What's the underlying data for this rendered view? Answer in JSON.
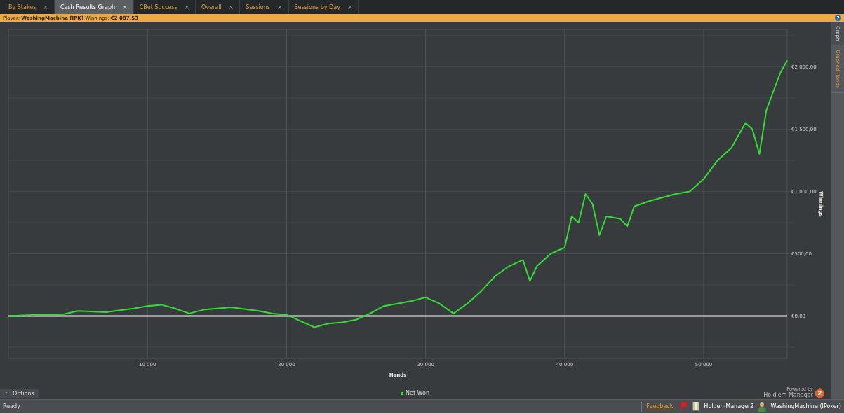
{
  "tabs": [
    {
      "label": "By Stakes",
      "selected": false,
      "close": "×"
    },
    {
      "label": "Cash Results Graph",
      "selected": true,
      "close": "×"
    },
    {
      "label": "CBet Success",
      "selected": false,
      "close": "×"
    },
    {
      "label": "Overall",
      "selected": false,
      "close": "×"
    },
    {
      "label": "Sessions",
      "selected": false,
      "close": "×"
    },
    {
      "label": "Sessions by Day",
      "selected": false,
      "close": "×"
    }
  ],
  "info_bar": {
    "player_label": "Player:",
    "player": "WashingMachine [IPK]",
    "winnings_label": "Winnings:",
    "winnings": "€2 087,53",
    "help": "?"
  },
  "side_tabs": [
    {
      "label": "Graph",
      "selected": true
    },
    {
      "label": "Graphed Hands",
      "selected": false
    }
  ],
  "graph": {
    "chart_data": {
      "type": "line",
      "grid": true,
      "xlabel": "Hands",
      "ylabel": "Winnings",
      "xlim": [
        0,
        56000
      ],
      "ylim": [
        -340,
        2300
      ],
      "xticks": [
        {
          "value": 10000,
          "label": "10 000"
        },
        {
          "value": 20000,
          "label": "20 000"
        },
        {
          "value": 30000,
          "label": "30 000"
        },
        {
          "value": 40000,
          "label": "40 000"
        },
        {
          "value": 50000,
          "label": "50 000"
        }
      ],
      "yticks": [
        {
          "value": 0,
          "label": "€0,00"
        },
        {
          "value": 500,
          "label": "€500,00"
        },
        {
          "value": 1000,
          "label": "€1 000,00"
        },
        {
          "value": 1500,
          "label": "€1 500,00"
        },
        {
          "value": 2000,
          "label": "€2 000,00"
        }
      ],
      "x": [
        0,
        2000,
        4000,
        5000,
        7000,
        9000,
        10000,
        11000,
        12000,
        13000,
        14000,
        16000,
        18000,
        19000,
        20000,
        21000,
        22000,
        23000,
        24000,
        25000,
        26000,
        27000,
        28000,
        29000,
        30000,
        31000,
        32000,
        33000,
        34000,
        35000,
        36000,
        37000,
        37500,
        38000,
        39000,
        40000,
        40500,
        41000,
        41500,
        42000,
        42500,
        43000,
        44000,
        44500,
        45000,
        46000,
        47000,
        48000,
        49000,
        50000,
        51000,
        52000,
        53000,
        53500,
        54000,
        54500,
        55000,
        55500,
        56000
      ],
      "series": [
        {
          "name": "Net Won",
          "color": "#33dd33",
          "values": [
            0,
            10,
            15,
            40,
            30,
            60,
            80,
            90,
            60,
            20,
            50,
            70,
            40,
            20,
            10,
            -40,
            -90,
            -60,
            -50,
            -30,
            20,
            80,
            100,
            120,
            150,
            100,
            20,
            100,
            200,
            320,
            400,
            450,
            280,
            400,
            500,
            550,
            800,
            750,
            980,
            900,
            650,
            800,
            780,
            720,
            880,
            920,
            950,
            980,
            1000,
            1100,
            1250,
            1350,
            1550,
            1500,
            1300,
            1650,
            1800,
            1950,
            2050
          ]
        }
      ]
    },
    "options": "Options",
    "options_caret": "^",
    "powered_by": "Powered by",
    "brand": "Hold'em Manager",
    "brand_badge": "2"
  },
  "status_bar": {
    "status": "Ready",
    "feedback": "Feedback",
    "app": "HoldemManager2",
    "user": "WashingMachine (IPoker)"
  }
}
